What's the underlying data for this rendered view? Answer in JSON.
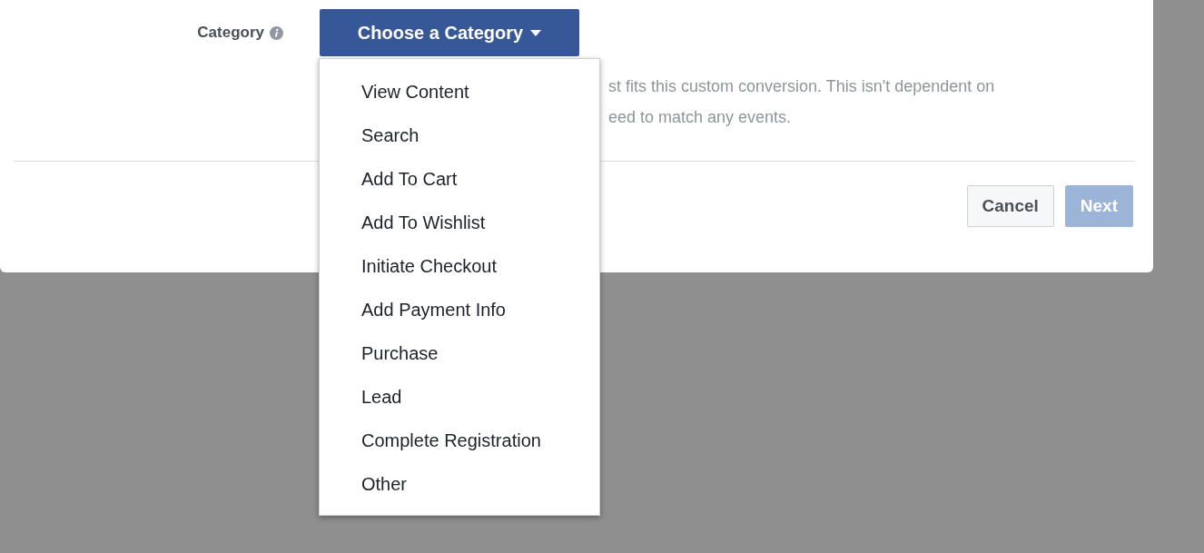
{
  "form": {
    "label": "Category",
    "dropdown": {
      "value": "Choose a Category",
      "expanded": true
    },
    "description_lines": [
      "st fits this custom conversion. This isn't dependent on",
      "eed to match any events."
    ]
  },
  "menu": {
    "items": [
      {
        "label": "View Content"
      },
      {
        "label": "Search"
      },
      {
        "label": "Add To Cart"
      },
      {
        "label": "Add To Wishlist"
      },
      {
        "label": "Initiate Checkout"
      },
      {
        "label": "Add Payment Info"
      },
      {
        "label": "Purchase"
      },
      {
        "label": "Lead"
      },
      {
        "label": "Complete Registration"
      },
      {
        "label": "Other"
      }
    ]
  },
  "buttons": [
    {
      "label": "Cancel",
      "kind": "secondary",
      "disabled": false
    },
    {
      "label": "Next",
      "kind": "primary",
      "disabled": true
    }
  ]
}
